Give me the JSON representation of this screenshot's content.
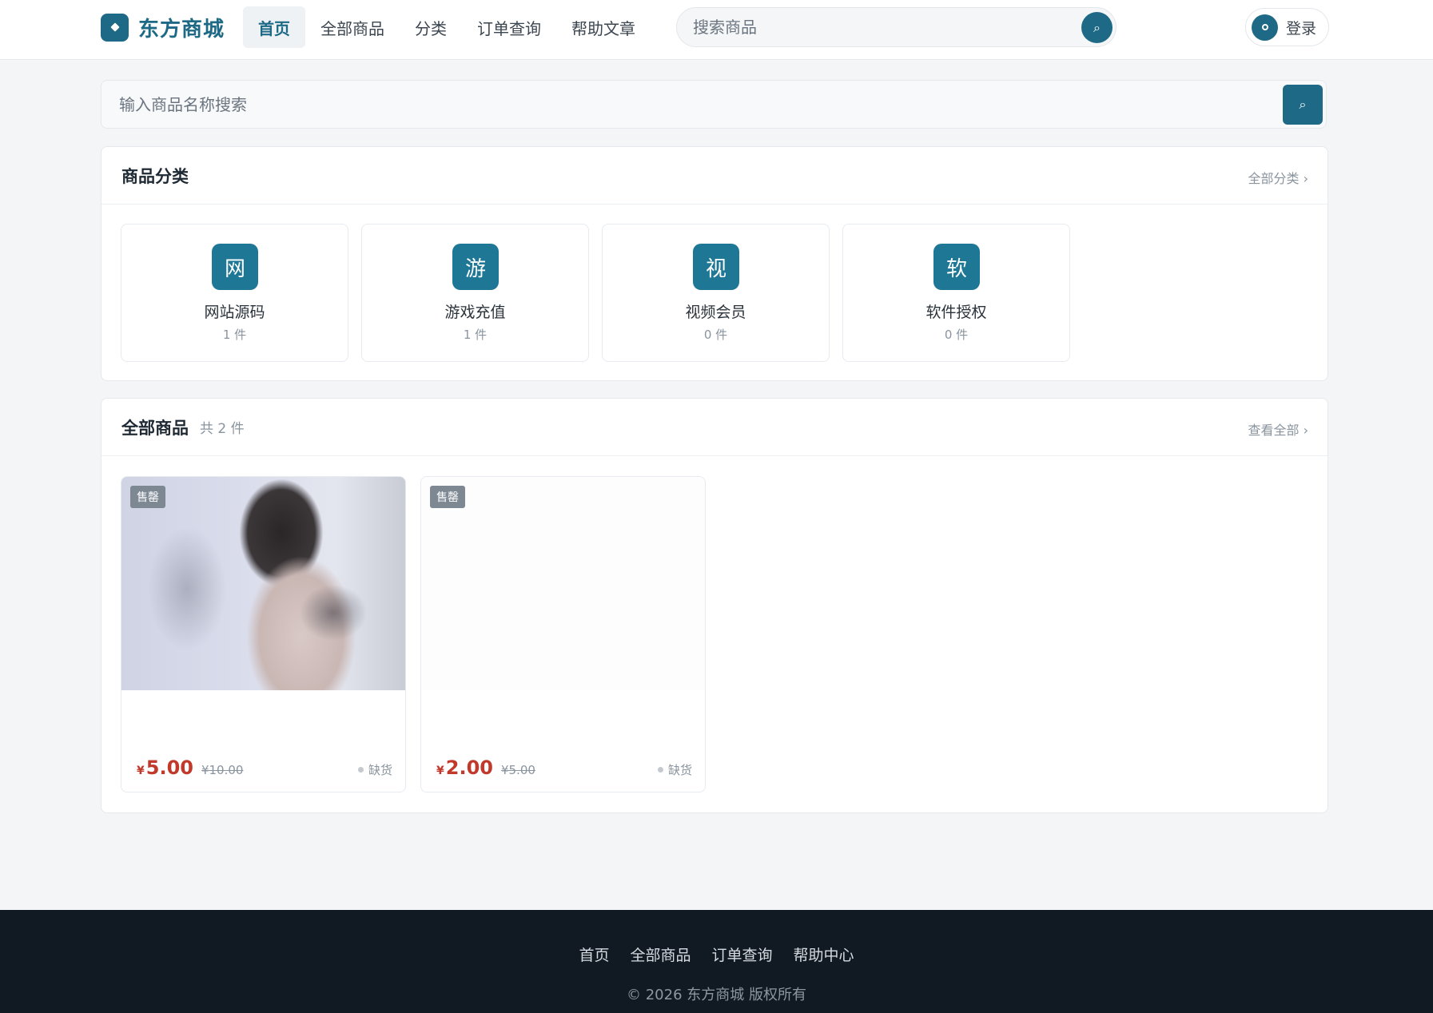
{
  "header": {
    "brand": "东方商城",
    "nav": [
      {
        "label": "首页",
        "active": true
      },
      {
        "label": "全部商品",
        "active": false
      },
      {
        "label": "分类",
        "active": false
      },
      {
        "label": "订单查询",
        "active": false
      },
      {
        "label": "帮助文章",
        "active": false
      }
    ],
    "search_placeholder": "搜索商品",
    "search_icon": "⌕",
    "login_label": "登录"
  },
  "main_search": {
    "placeholder": "输入商品名称搜索",
    "icon": "⌕"
  },
  "categories": {
    "title": "商品分类",
    "link": "全部分类 ›",
    "items": [
      {
        "icon_char": "网",
        "name": "网站源码",
        "count": "1 件"
      },
      {
        "icon_char": "游",
        "name": "游戏充值",
        "count": "1 件"
      },
      {
        "icon_char": "视",
        "name": "视频会员",
        "count": "0 件"
      },
      {
        "icon_char": "软",
        "name": "软件授权",
        "count": "0 件"
      }
    ]
  },
  "products": {
    "title": "全部商品",
    "count": "共 2 件",
    "link": "查看全部 ›",
    "items": [
      {
        "badge": "售罄",
        "currency": "¥",
        "price": "5.00",
        "old_price": "¥10.00",
        "stock": "缺货",
        "image": "photo"
      },
      {
        "badge": "售罄",
        "currency": "¥",
        "price": "2.00",
        "old_price": "¥5.00",
        "stock": "缺货",
        "image": "blank"
      }
    ]
  },
  "footer": {
    "links": [
      "首页",
      "全部商品",
      "订单查询",
      "帮助中心"
    ],
    "copyright": "© 2026 东方商城 版权所有"
  },
  "colors": {
    "primary": "#1e6a86",
    "price": "#c0392b",
    "footer_bg": "#111a23"
  }
}
